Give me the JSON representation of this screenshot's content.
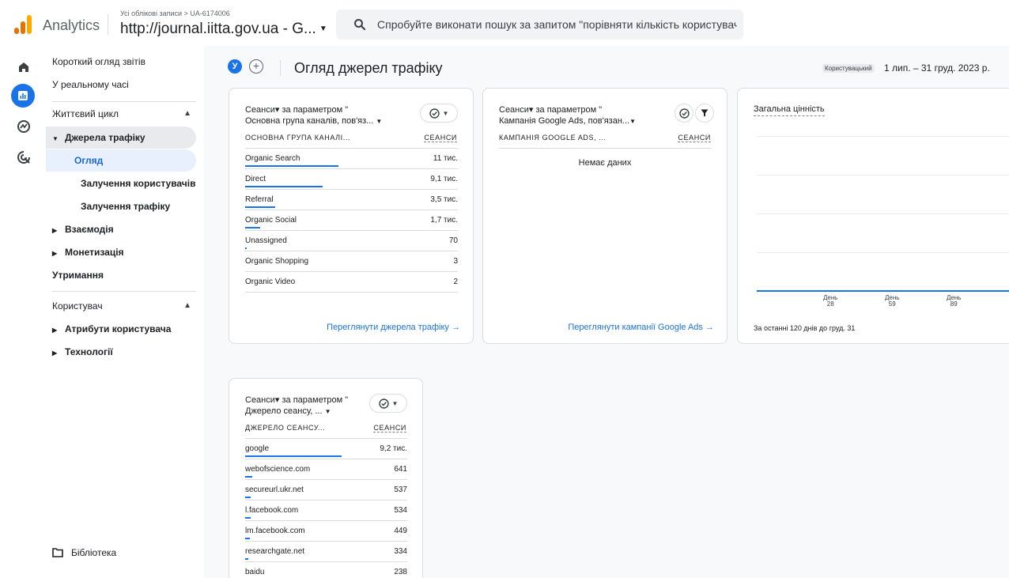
{
  "header": {
    "app_name": "Analytics",
    "account_breadcrumb": "Усі облікові записи > UA-6174006",
    "property_name": "http://journal.iitta.gov.ua - G...",
    "search_placeholder": "Спробуйте виконати пошук за запитом \"порівняти кількість користувач...",
    "logo_colors": [
      "#f9ab00",
      "#e37400",
      "#e37400"
    ]
  },
  "rail": {
    "icons": [
      "home-icon",
      "reports-icon",
      "explore-icon",
      "advertising-icon"
    ],
    "active": "reports-icon",
    "accent": "#1a73e8"
  },
  "nav": {
    "reports_snapshot": "Короткий огляд звітів",
    "realtime": "У реальному часі",
    "lifecycle": "Життєвий цикл",
    "acquisition": "Джерела трафіку",
    "overview": "Огляд",
    "user_acquisition": "Залучення користувачів",
    "traffic_acquisition": "Залучення трафіку",
    "engagement": "Взаємодія",
    "monetization": "Монетизація",
    "retention": "Утримання",
    "user": "Користувач",
    "user_attributes": "Атрибути користувача",
    "tech": "Технології",
    "library": "Бібліотека"
  },
  "page": {
    "avatar_letter": "У",
    "title": "Огляд джерел трафіку",
    "date_badge": "Користувацький",
    "date_range": "1 лип. – 31 груд. 2023 р."
  },
  "card_channels": {
    "title_line1": "Сеанси▾ за параметром \"",
    "title_line2": "Основна група каналів, пов'яз...",
    "col_dimension": "ОСНОВНА ГРУПА КАНАЛІ...",
    "col_metric": "СЕАНСИ",
    "rows": [
      {
        "label": "Organic Search",
        "value": "11 тис.",
        "share": 1.0
      },
      {
        "label": "Direct",
        "value": "9,1 тис.",
        "share": 0.83
      },
      {
        "label": "Referral",
        "value": "3,5 тис.",
        "share": 0.32
      },
      {
        "label": "Organic Social",
        "value": "1,7 тис.",
        "share": 0.16
      },
      {
        "label": "Unassigned",
        "value": "70",
        "share": 0.006
      },
      {
        "label": "Organic Shopping",
        "value": "3",
        "share": 0
      },
      {
        "label": "Organic Video",
        "value": "2",
        "share": 0
      }
    ],
    "link": "Переглянути джерела трафіку"
  },
  "card_ads": {
    "title_line1": "Сеанси▾ за параметром \"",
    "title_line2": "Кампанія Google Ads, пов'язан...",
    "col_dimension": "КАМПАНІЯ GOOGLE ADS, ...",
    "col_metric": "СЕАНСИ",
    "no_data": "Немає даних",
    "link": "Переглянути кампанії Google Ads"
  },
  "card_ltv": {
    "title": "Загальна цінність",
    "ticks": [
      {
        "label": "День",
        "value": "28"
      },
      {
        "label": "День",
        "value": "59"
      },
      {
        "label": "День",
        "value": "89"
      }
    ],
    "footer": "За останні 120 днів до груд. 31"
  },
  "card_source": {
    "title_line1": "Сеанси▾ за параметром \"",
    "title_line2": "Джерело сеансу, ...",
    "col_dimension": "ДЖЕРЕЛО СЕАНСУ...",
    "col_metric": "СЕАНСИ",
    "rows": [
      {
        "label": "google",
        "value": "9,2 тис.",
        "share": 1.0
      },
      {
        "label": "webofscience.com",
        "value": "641",
        "share": 0.07
      },
      {
        "label": "secureurl.ukr.net",
        "value": "537",
        "share": 0.058
      },
      {
        "label": "l.facebook.com",
        "value": "534",
        "share": 0.058
      },
      {
        "label": "lm.facebook.com",
        "value": "449",
        "share": 0.049
      },
      {
        "label": "researchgate.net",
        "value": "334",
        "share": 0.036
      },
      {
        "label": "baidu",
        "value": "238",
        "share": 0.026
      }
    ]
  }
}
